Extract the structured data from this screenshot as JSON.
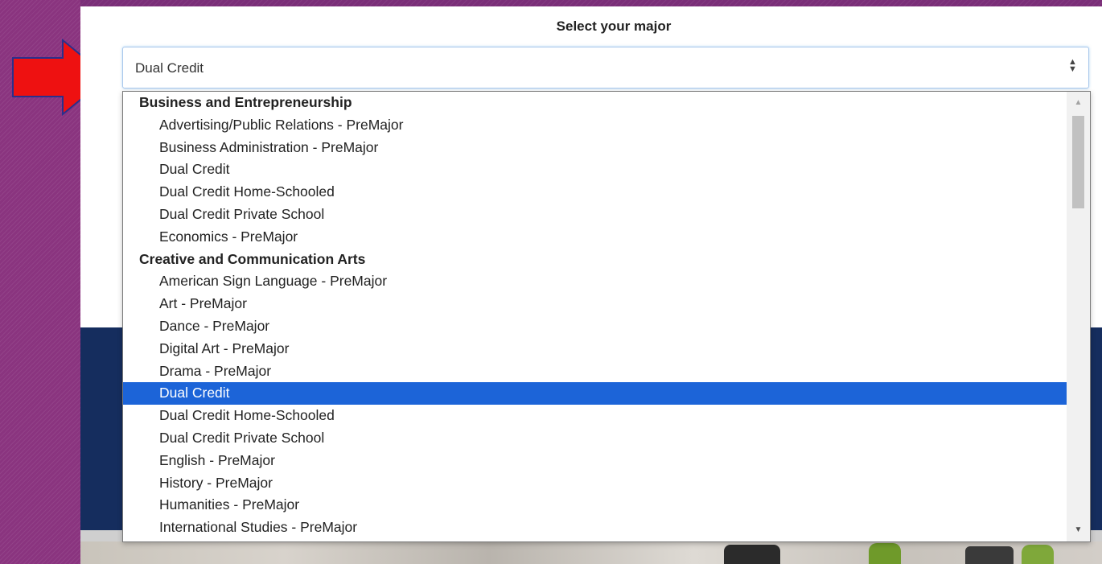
{
  "header": {
    "title": "Select your major"
  },
  "select": {
    "value": "Dual Credit",
    "caret": "▲▼"
  },
  "options": [
    {
      "label": "Business and Entrepreneurship",
      "group": true
    },
    {
      "label": "Advertising/Public Relations - PreMajor"
    },
    {
      "label": "Business Administration - PreMajor"
    },
    {
      "label": "Dual Credit"
    },
    {
      "label": "Dual Credit Home-Schooled"
    },
    {
      "label": "Dual Credit Private School"
    },
    {
      "label": "Economics - PreMajor"
    },
    {
      "label": "Creative and Communication Arts",
      "group": true
    },
    {
      "label": "American Sign Language - PreMajor"
    },
    {
      "label": "Art - PreMajor"
    },
    {
      "label": "Dance - PreMajor"
    },
    {
      "label": "Digital Art - PreMajor"
    },
    {
      "label": "Drama - PreMajor"
    },
    {
      "label": "Dual Credit",
      "selected": true
    },
    {
      "label": "Dual Credit Home-Schooled"
    },
    {
      "label": "Dual Credit Private School"
    },
    {
      "label": "English - PreMajor"
    },
    {
      "label": "History - PreMajor"
    },
    {
      "label": "Humanities - PreMajor"
    },
    {
      "label": "International Studies - PreMajor"
    }
  ],
  "scroll": {
    "up_icon": "▲",
    "down_icon": "▼",
    "position": 0.03
  },
  "colors": {
    "selected": "#1c64d8",
    "arrow": "#ee1111",
    "background": "#7a2e78",
    "navy": "#152d5e"
  }
}
